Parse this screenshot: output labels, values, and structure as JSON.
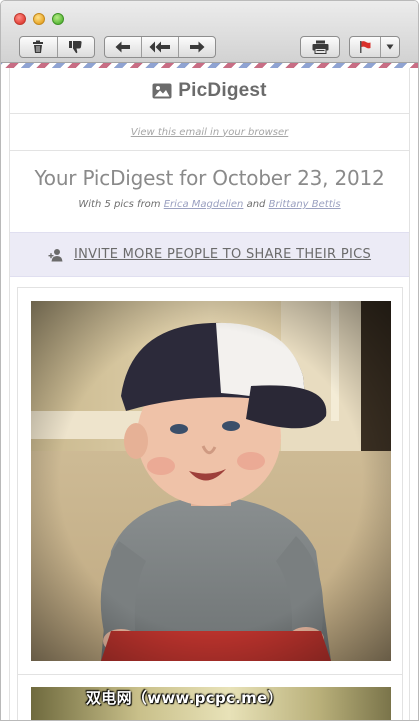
{
  "toolbar": {
    "buttons": {
      "delete": "trash-icon",
      "junk": "thumbs-down-icon",
      "reply": "reply-icon",
      "reply_all": "reply-all-icon",
      "forward": "forward-icon",
      "print": "printer-icon",
      "flag": "flag-icon"
    }
  },
  "email": {
    "logo_text": "PicDigest",
    "view_in_browser": "View this email in your browser",
    "title": "Your PicDigest for October 23, 2012",
    "subtitle": {
      "prefix": "With 5 pics from",
      "name1": "Erica Magdelien",
      "conj": "and",
      "name2": "Brittany Bettis"
    },
    "invite_text": "INVITE MORE PEOPLE TO SHARE THEIR PICS"
  },
  "watermark": "双电网（www.pcpc.me）",
  "colors": {
    "invite_bg": "#ecebf6",
    "link": "#9aa0c0",
    "airmail_red": "#c86d84",
    "airmail_blue": "#8fa3d2"
  }
}
